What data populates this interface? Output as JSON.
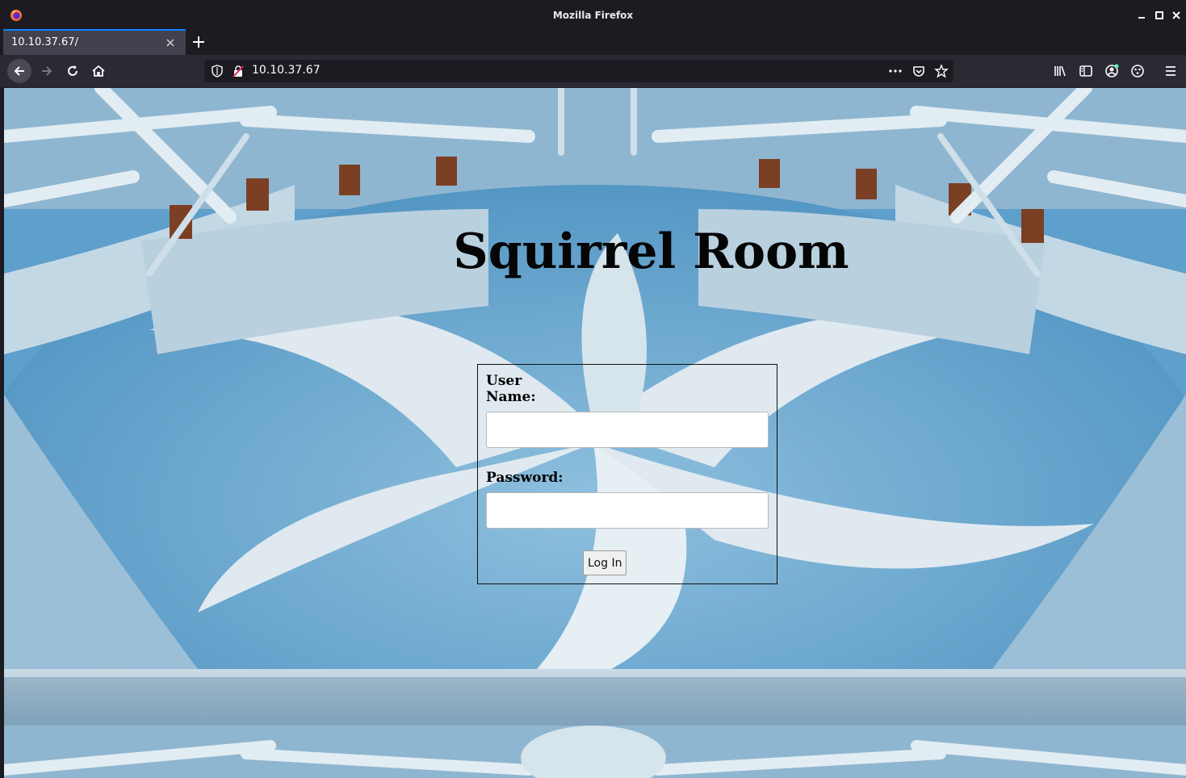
{
  "window": {
    "title": "Mozilla Firefox"
  },
  "tabs": [
    {
      "label": "10.10.37.67/",
      "active": true
    }
  ],
  "toolbar": {
    "url": "10.10.37.67"
  },
  "page": {
    "title": "Squirrel Room",
    "form": {
      "username_label": "User Name:",
      "username_value": "",
      "password_label": "Password:",
      "password_value": "",
      "submit_label": "Log In"
    }
  },
  "colors": {
    "chrome_dark": "#1c1b22",
    "toolbar": "#2b2a33",
    "tab_active": "#42414d",
    "accent": "#0a84ff",
    "floor_blue": "#6aa7d1",
    "floor_white": "#dfe9ef"
  },
  "icons": [
    "firefox-icon",
    "minimize-icon",
    "maximize-icon",
    "close-icon",
    "tab-close-icon",
    "plus-icon",
    "back-arrow-icon",
    "forward-arrow-icon",
    "reload-icon",
    "home-icon",
    "shield-icon",
    "insecure-lock-icon",
    "more-dots-icon",
    "pocket-icon",
    "star-icon",
    "library-icon",
    "sidebar-icon",
    "account-icon",
    "extension-icon",
    "hamburger-menu-icon"
  ]
}
